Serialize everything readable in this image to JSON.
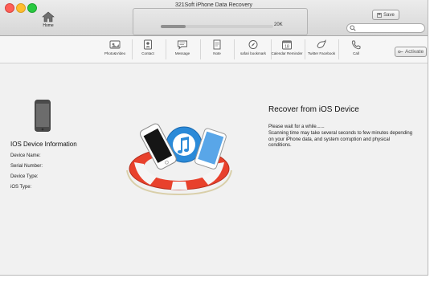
{
  "window": {
    "title": "321Soft iPhone Data Recovery"
  },
  "header": {
    "home_label": "Home",
    "progress_size": "20K",
    "progress_fraction": 0.22,
    "save_label": "Save",
    "search_value": "",
    "search_placeholder": ""
  },
  "toolbar": {
    "items": [
      {
        "label": "Photo&Video",
        "icon": "photo-video-icon"
      },
      {
        "label": "Contact",
        "icon": "contact-icon"
      },
      {
        "label": "Message",
        "icon": "message-icon"
      },
      {
        "label": "Note",
        "icon": "note-icon"
      },
      {
        "label": "safari bookmark",
        "icon": "safari-bookmark-icon"
      },
      {
        "label": "Calendar Reminder",
        "icon": "calendar-reminder-icon"
      },
      {
        "label": "Twitter Facebook",
        "icon": "twitter-facebook-icon"
      },
      {
        "label": "Call",
        "icon": "call-icon"
      }
    ],
    "activate_label": "Activate"
  },
  "device_info": {
    "title": "IOS Device Information",
    "fields": [
      "Device Name:",
      "Serial Number:",
      "Device Type:",
      "iOS Type:"
    ]
  },
  "main": {
    "heading": "Recover from iOS Device",
    "wait_text": "Please wait for a while......",
    "description": "Scanning time may take several seconds to few minutes depending on your iPhone data, and system corruption and physical conditions."
  },
  "colors": {
    "lifebuoy_red": "#e8412c",
    "itunes_blue": "#2b8ad8"
  }
}
